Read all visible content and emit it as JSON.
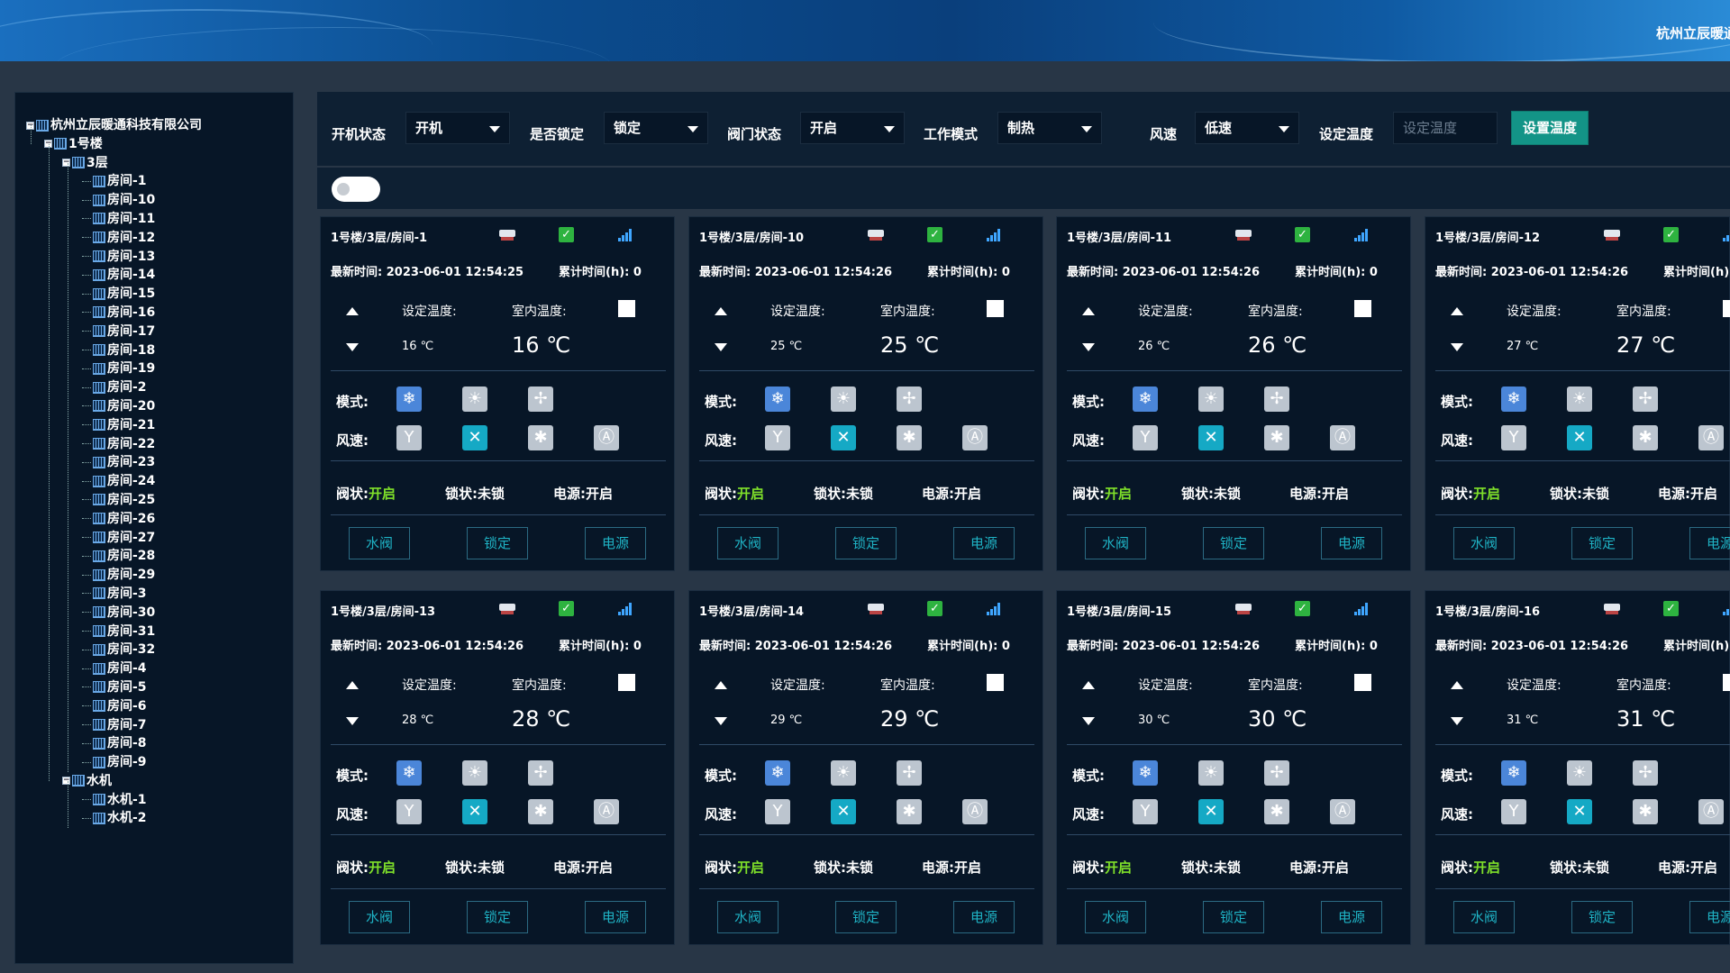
{
  "header": {
    "company": "杭州立辰暖通"
  },
  "tree": {
    "root": "杭州立辰暖通科技有限公司",
    "building": "1号楼",
    "floor": "3层",
    "rooms": [
      "房间-1",
      "房间-10",
      "房间-11",
      "房间-12",
      "房间-13",
      "房间-14",
      "房间-15",
      "房间-16",
      "房间-17",
      "房间-18",
      "房间-19",
      "房间-2",
      "房间-20",
      "房间-21",
      "房间-22",
      "房间-23",
      "房间-24",
      "房间-25",
      "房间-26",
      "房间-27",
      "房间-28",
      "房间-29",
      "房间-3",
      "房间-30",
      "房间-31",
      "房间-32",
      "房间-4",
      "房间-5",
      "房间-6",
      "房间-7",
      "房间-8",
      "房间-9"
    ],
    "water_group": "水机",
    "water_items": [
      "水机-1",
      "水机-2"
    ]
  },
  "filters": {
    "power_label": "开机状态",
    "power_value": "开机",
    "lock_label": "是否锁定",
    "lock_value": "锁定",
    "valve_label": "阀门状态",
    "valve_value": "开启",
    "mode_label": "工作模式",
    "mode_value": "制热",
    "fan_label": "风速",
    "fan_value": "低速",
    "settemp_label": "设定温度",
    "settemp_placeholder": "设定温度",
    "settemp_button": "设置温度"
  },
  "card_labels": {
    "set_temp": "设定温度:",
    "room_temp": "室内温度:",
    "mode": "模式:",
    "fan": "风速:",
    "valve_prefix": "阀状:",
    "valve_value": "开启",
    "lock_status": "锁状:未锁",
    "power_status": "电源:开启",
    "btn_valve": "水阀",
    "btn_lock": "锁定",
    "btn_power": "电源",
    "accum_full": "累计时间(h): 0",
    "accum_cut": "累计时间(h):"
  },
  "cards": [
    {
      "title": "1号楼/3层/房间-1",
      "time": "最新时间: 2023-06-01 12:54:25",
      "set_temp": "16 ℃",
      "room_temp": "16 ℃"
    },
    {
      "title": "1号楼/3层/房间-10",
      "time": "最新时间: 2023-06-01 12:54:26",
      "set_temp": "25 ℃",
      "room_temp": "25 ℃"
    },
    {
      "title": "1号楼/3层/房间-11",
      "time": "最新时间: 2023-06-01 12:54:26",
      "set_temp": "26 ℃",
      "room_temp": "26 ℃"
    },
    {
      "title": "1号楼/3层/房间-12",
      "time": "最新时间: 2023-06-01 12:54:26",
      "set_temp": "27 ℃",
      "room_temp": "27 ℃"
    },
    {
      "title": "1号楼/3层/房间-13",
      "time": "最新时间: 2023-06-01 12:54:26",
      "set_temp": "28 ℃",
      "room_temp": "28 ℃"
    },
    {
      "title": "1号楼/3层/房间-14",
      "time": "最新时间: 2023-06-01 12:54:26",
      "set_temp": "29 ℃",
      "room_temp": "29 ℃"
    },
    {
      "title": "1号楼/3层/房间-15",
      "time": "最新时间: 2023-06-01 12:54:26",
      "set_temp": "30 ℃",
      "room_temp": "30 ℃"
    },
    {
      "title": "1号楼/3层/房间-16",
      "time": "最新时间: 2023-06-01 12:54:26",
      "set_temp": "31 ℃",
      "room_temp": "31 ℃"
    }
  ],
  "icons": {
    "mode": [
      "snowflake-icon",
      "sun-icon",
      "fan-icon"
    ],
    "fan": [
      "fan-low-icon",
      "fan-mid-icon",
      "fan-high-icon",
      "fan-auto-icon"
    ]
  },
  "colors": {
    "accent": "#139487",
    "valve_on": "#7fe02a",
    "card_bg": "#071627"
  }
}
